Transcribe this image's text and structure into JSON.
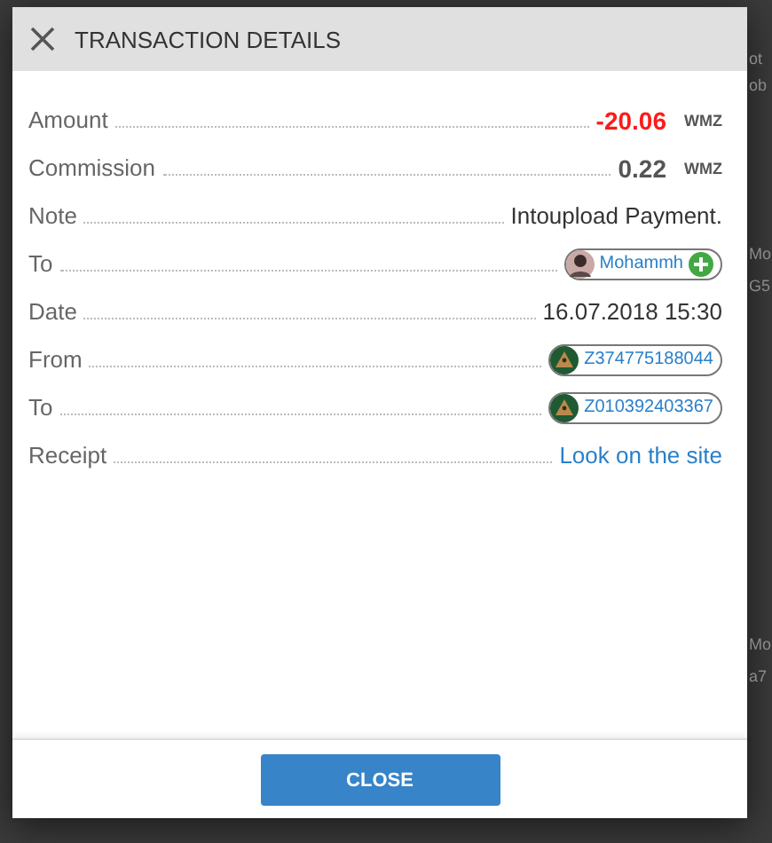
{
  "dialog": {
    "title": "TRANSACTION DETAILS",
    "close_button": "CLOSE"
  },
  "rows": [
    {
      "kind": "amount",
      "label": "Amount",
      "value": "-20.06",
      "unit": "WMZ",
      "negative": true
    },
    {
      "kind": "amount",
      "label": "Commission",
      "value": "0.22",
      "unit": "WMZ",
      "negative": false
    },
    {
      "kind": "text",
      "label": "Note",
      "value": "Intoupload Payment."
    },
    {
      "kind": "user",
      "label": "To",
      "value": "Mohammh"
    },
    {
      "kind": "text",
      "label": "Date",
      "value": "16.07.2018 15:30"
    },
    {
      "kind": "wallet",
      "label": "From",
      "value": "Z374775188044"
    },
    {
      "kind": "wallet",
      "label": "To",
      "value": "Z010392403367"
    },
    {
      "kind": "link",
      "label": "Receipt",
      "value": "Look on the site"
    }
  ],
  "background_fragments": [
    {
      "text": "ot"
    },
    {
      "text": "ob"
    },
    {
      "text": "Mo"
    },
    {
      "text": "G5"
    },
    {
      "text": "Mo"
    },
    {
      "text": "a7"
    }
  ]
}
